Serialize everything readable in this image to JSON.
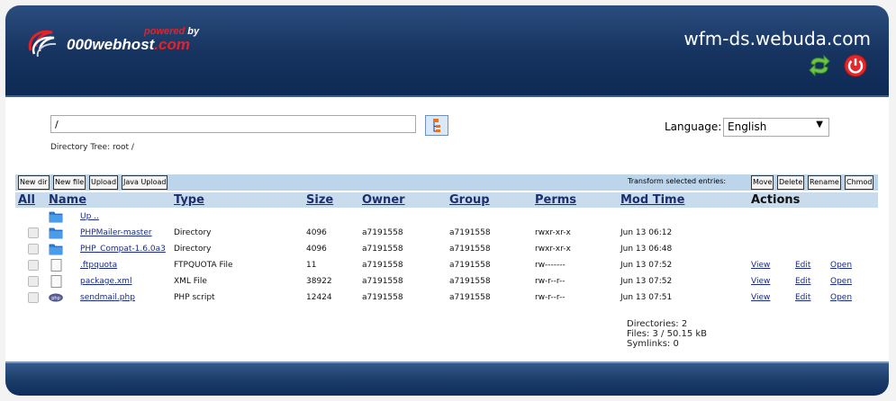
{
  "header": {
    "powered_by_prefix": "powered",
    "powered_by_suffix": "by",
    "brand_main": "000webhost",
    "brand_suffix": ".com",
    "domain": "wfm-ds.webuda.com"
  },
  "path": {
    "value": "/"
  },
  "directory_tree": "Directory Tree: root /",
  "language": {
    "label": "Language:",
    "selected": "English"
  },
  "toolbar": {
    "new_dir": "New dir",
    "new_file": "New file",
    "upload": "Upload",
    "java_upload": "Java Upload",
    "transform_label": "Transform selected entries:",
    "move": "Move",
    "delete": "Delete",
    "rename": "Rename",
    "chmod": "Chmod"
  },
  "columns": {
    "all": "All",
    "name": "Name",
    "type": "Type",
    "size": "Size",
    "owner": "Owner",
    "group": "Group",
    "perms": "Perms",
    "mod_time": "Mod Time",
    "actions": "Actions"
  },
  "up_label": "Up ..",
  "rows": [
    {
      "name": "PHPMailer-master",
      "type": "Directory",
      "size": "4096",
      "owner": "a7191558",
      "group": "a7191558",
      "perms": "rwxr-xr-x",
      "mod_time": "Jun 13 06:12",
      "icon": "folder-icon"
    },
    {
      "name": "PHP_Compat-1.6.0a3",
      "type": "Directory",
      "size": "4096",
      "owner": "a7191558",
      "group": "a7191558",
      "perms": "rwxr-xr-x",
      "mod_time": "Jun 13 06:48",
      "icon": "folder-icon"
    },
    {
      "name": ".ftpquota",
      "type": "FTPQUOTA File",
      "size": "11",
      "owner": "a7191558",
      "group": "a7191558",
      "perms": "rw-------",
      "mod_time": "Jun 13 07:52",
      "icon": "file-icon",
      "view": "View",
      "edit": "Edit",
      "open": "Open"
    },
    {
      "name": "package.xml",
      "type": "XML File",
      "size": "38922",
      "owner": "a7191558",
      "group": "a7191558",
      "perms": "rw-r--r--",
      "mod_time": "Jun 13 07:52",
      "icon": "file-icon",
      "view": "View",
      "edit": "Edit",
      "open": "Open"
    },
    {
      "name": "sendmail.php",
      "type": "PHP script",
      "size": "12424",
      "owner": "a7191558",
      "group": "a7191558",
      "perms": "rw-r--r--",
      "mod_time": "Jun 13 07:51",
      "icon": "php-icon",
      "view": "View",
      "edit": "Edit",
      "open": "Open"
    }
  ],
  "stats": {
    "directories": "Directories: 2",
    "files": "Files: 3 / 50.15 kB",
    "symlinks": "Symlinks: 0"
  }
}
